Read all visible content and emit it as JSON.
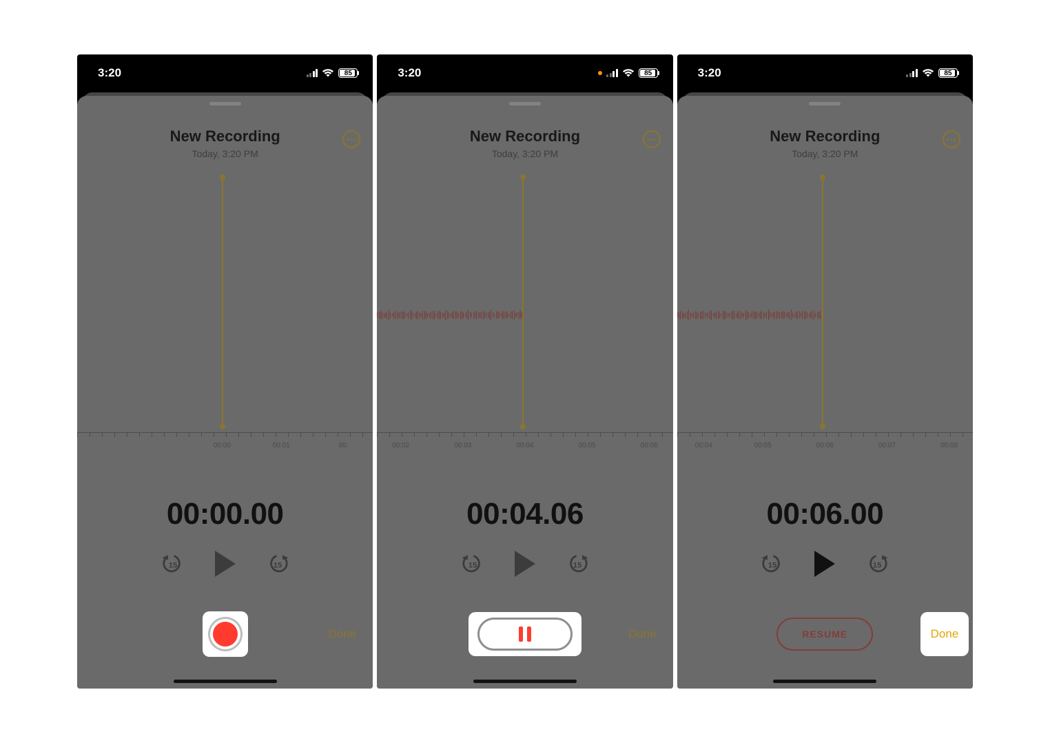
{
  "status": {
    "time": "3:20",
    "battery": "85"
  },
  "header": {
    "title": "New Recording",
    "subtitle": "Today, 3:20 PM"
  },
  "screens": [
    {
      "id": "start",
      "playhead_percent": 49,
      "waveform": false,
      "ticks": [
        {
          "pos": 49,
          "label": "00:00"
        },
        {
          "pos": 69,
          "label": "00:01"
        },
        {
          "pos": 90,
          "label": "00:"
        }
      ],
      "timer": "00:00.00",
      "play_active": false,
      "bottom": {
        "type": "record",
        "done_link": true
      }
    },
    {
      "id": "recording",
      "rec_indicator": true,
      "playhead_percent": 49,
      "waveform": true,
      "ticks": [
        {
          "pos": 8,
          "label": "00:02"
        },
        {
          "pos": 29,
          "label": "00:03"
        },
        {
          "pos": 50,
          "label": "00:04"
        },
        {
          "pos": 71,
          "label": "00:05"
        },
        {
          "pos": 92,
          "label": "00:06"
        }
      ],
      "timer": "00:04.06",
      "play_active": false,
      "bottom": {
        "type": "pause",
        "done_link": true
      }
    },
    {
      "id": "paused",
      "playhead_percent": 49,
      "waveform": true,
      "ticks": [
        {
          "pos": 9,
          "label": "00:04"
        },
        {
          "pos": 29,
          "label": "00:05"
        },
        {
          "pos": 50,
          "label": "00:06"
        },
        {
          "pos": 71,
          "label": "00:07"
        },
        {
          "pos": 92,
          "label": "00:08"
        }
      ],
      "timer": "00:06.00",
      "play_active": true,
      "bottom": {
        "type": "resume",
        "resume_label": "RESUME",
        "done_box": true
      }
    }
  ],
  "labels": {
    "done": "Done"
  }
}
